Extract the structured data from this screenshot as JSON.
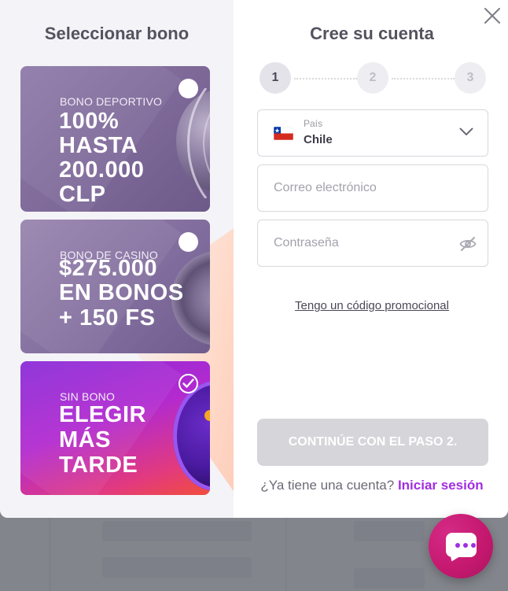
{
  "bonus_panel": {
    "title": "Seleccionar bono",
    "cards": [
      {
        "subtitle": "BONO DEPORTIVO",
        "lines": [
          "100%",
          "HASTA",
          "200.000",
          "CLP"
        ],
        "selected": false
      },
      {
        "subtitle": "BONO DE CASINO",
        "lines": [
          "$275.000",
          "EN BONOS",
          "+ 150 FS"
        ],
        "selected": false
      },
      {
        "subtitle": "SIN BONO",
        "lines": [
          "ELEGIR",
          "MÁS",
          "TARDE"
        ],
        "selected": true
      }
    ]
  },
  "signup": {
    "title": "Cree su cuenta",
    "steps": [
      "1",
      "2",
      "3"
    ],
    "active_step": 1,
    "country": {
      "label": "País",
      "value": "Chile",
      "flag_icon": "chile-flag-icon"
    },
    "email_placeholder": "Correo electrónico",
    "password_placeholder": "Contraseña",
    "promo_link": "Tengo un código promocional",
    "continue_button": "CONTINÚE CON EL PASO 2.",
    "login_prompt": "¿Ya tiene una cuenta?",
    "login_link": "Iniciar sesión"
  },
  "colors": {
    "accent": "#a12ee0",
    "chat_button": "#c4186e",
    "disabled_button": "#d5d5da"
  }
}
